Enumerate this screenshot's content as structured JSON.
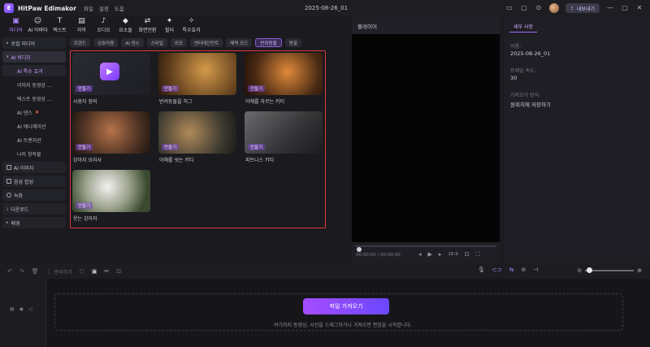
{
  "app": {
    "title": "HitPaw Edimakor",
    "menu": [
      "파일",
      "설정",
      "도움"
    ],
    "project_name": "2025-08-26_01",
    "export_label": "내보내기"
  },
  "toolbar": [
    {
      "icon": "media-icon",
      "glyph": "▣",
      "label": "미디어",
      "active": true
    },
    {
      "icon": "ai-avatar-icon",
      "glyph": "☺",
      "label": "AI 아바타",
      "active": false
    },
    {
      "icon": "text-icon",
      "glyph": "T",
      "label": "텍스트",
      "active": false
    },
    {
      "icon": "subtitle-icon",
      "glyph": "▤",
      "label": "자막",
      "active": false
    },
    {
      "icon": "audio-icon",
      "glyph": "♪",
      "label": "오디오",
      "active": false
    },
    {
      "icon": "elements-icon",
      "glyph": "◆",
      "label": "요소들",
      "active": false
    },
    {
      "icon": "transition-icon",
      "glyph": "⇄",
      "label": "화면전환",
      "active": false
    },
    {
      "icon": "filter-icon",
      "glyph": "✦",
      "label": "필터",
      "active": false
    },
    {
      "icon": "effects-icon",
      "glyph": "✧",
      "label": "특수효과",
      "active": false
    }
  ],
  "sidebar": {
    "local_media": "로컬 미디어",
    "ai_video": "AI 비디오",
    "sub_items": [
      "AI 특수 효과",
      "이미지 동영상 ...",
      "텍스트 동영상 ...",
      "AI 댄스",
      "AI 애니메이션",
      "AI 트랜지션",
      "나의 창작물"
    ],
    "ai_image": "AI 이미지",
    "voice_synth": "음성 합성",
    "record": "녹화",
    "download": "다운로드",
    "background": "배경"
  },
  "categories": [
    "트렌드",
    "상호작용",
    "AI 댄스",
    "스타일",
    "외모",
    "엔터테인먼트",
    "매력 모드",
    "반려동물",
    "명절"
  ],
  "selected_category": "반려동물",
  "cards": [
    {
      "title": "사용자 정의",
      "make": "만들기"
    },
    {
      "title": "반려동물을 허그",
      "make": "만들기"
    },
    {
      "title": "야채를 자르는 키티",
      "make": "만들기"
    },
    {
      "title": "강아지 요리사",
      "make": "만들기"
    },
    {
      "title": "야채를 씻는 키티",
      "make": "만들기"
    },
    {
      "title": "피트니스 키티",
      "make": "만들기"
    },
    {
      "title": "웃는 강아지",
      "make": "만들기"
    }
  ],
  "preview": {
    "header": "플레이어",
    "time": "00:00:00 / 00:00:00",
    "ratio": "16:9"
  },
  "details": {
    "tab": "세부 사항",
    "name_label": "이름:",
    "name_value": "2025-08-26_01",
    "fps_label": "프레임 속도:",
    "fps_value": "30",
    "save_label": "가져오기 방식:",
    "save_value": "원위치에 저장하기"
  },
  "timeline": {
    "split_label": "분리하기",
    "import_button": "파일 가져오기",
    "hint": "여기까지 동영상, 사진을 드래그하거나 가져오면 편집을 시작합니다."
  },
  "colors": {
    "accent": "#a070ff",
    "highlight_border": "#e03a3a"
  }
}
